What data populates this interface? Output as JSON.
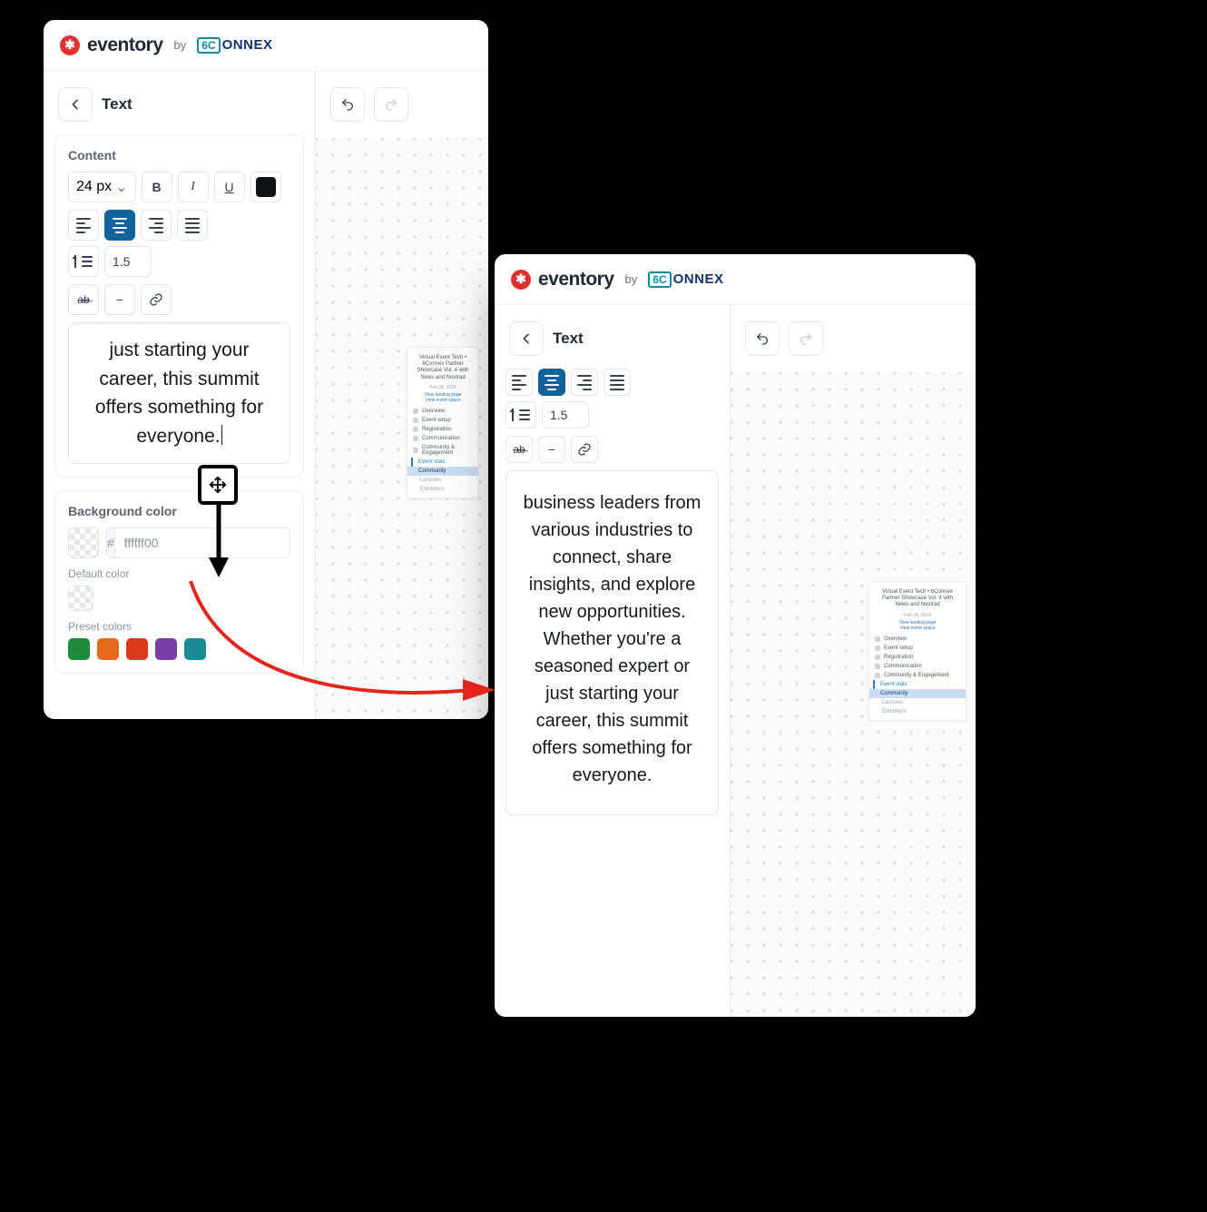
{
  "brand": {
    "name": "eventory",
    "by": "by",
    "partner_prefix": "6C",
    "partner_suffix": "ONNEX"
  },
  "panel_title": "Text",
  "content_section": {
    "title": "Content",
    "font_size": "24 px",
    "line_height": "1.5"
  },
  "text_preview_short": "just starting your career, this summit offers something for everyone.",
  "text_preview_long": "business leaders from various industries to connect, share insights, and explore new opportunities. Whether you're a seasoned expert or just starting your career, this summit offers something for everyone.",
  "bg_section": {
    "title": "Background color",
    "hash": "#",
    "hex_value": "ffffff00",
    "default_label": "Default color",
    "presets_label": "Preset colors",
    "preset_colors": [
      "#1e8a3b",
      "#e26a1a",
      "#d9391d",
      "#7a3fa6",
      "#188b94"
    ]
  },
  "minimap": {
    "head": "Virtual Event Tech • 6Connex Partner Showcase Vol. 4 with News and Nostrad",
    "date": "Feb 28, 2024",
    "links": [
      "View landing page",
      "View event space"
    ],
    "items": [
      {
        "label": "Overview"
      },
      {
        "label": "Event setup"
      },
      {
        "label": "Registration"
      },
      {
        "label": "Communication"
      },
      {
        "label": "Community & Engagement"
      },
      {
        "label": "Event stats",
        "stats": true
      },
      {
        "label": "Community",
        "highlight": true
      },
      {
        "label": "Lectures",
        "sub": true
      },
      {
        "label": "Exhibitors",
        "sub": true
      }
    ]
  }
}
